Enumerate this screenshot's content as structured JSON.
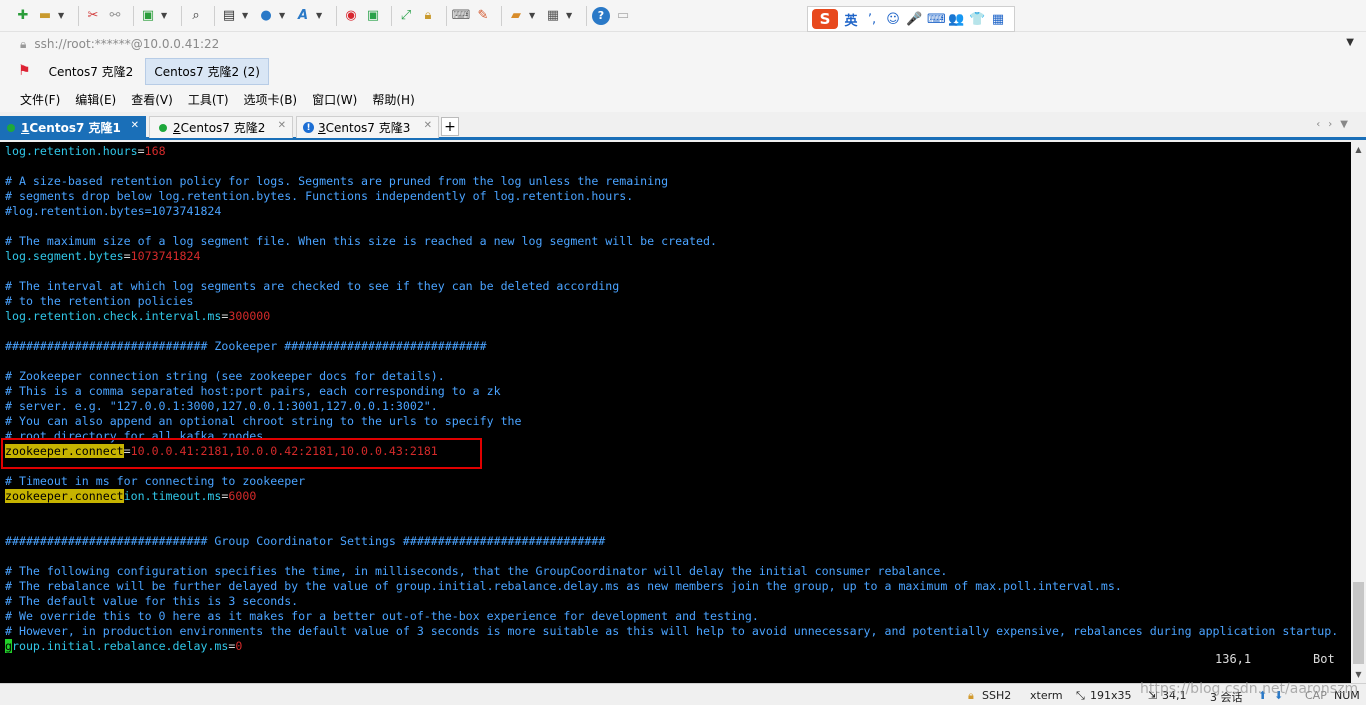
{
  "ime": {
    "logo": "S",
    "lang": "英",
    "items": [
      "ʼ,",
      "☺",
      "🎤",
      "⌨",
      "👥",
      "👕",
      "▦"
    ]
  },
  "address": {
    "url": "ssh://root:******@10.0.0.41:22"
  },
  "sessions": [
    "Centos7 克隆2",
    "Centos7 克隆2 (2)"
  ],
  "menu": [
    "文件(F)",
    "编辑(E)",
    "查看(V)",
    "工具(T)",
    "选项卡(B)",
    "窗口(W)",
    "帮助(H)"
  ],
  "tabs": [
    {
      "num": "1",
      "label": " Centos7 克隆1",
      "status": "connected",
      "active": true
    },
    {
      "num": "2",
      "label": " Centos7 克隆2",
      "status": "connected",
      "active": false
    },
    {
      "num": "3",
      "label": " Centos7 克隆3",
      "status": "warning",
      "active": false
    }
  ],
  "terminal": {
    "lines": [
      [
        [
          "k",
          "log.retention.hours"
        ],
        [
          "e",
          "="
        ],
        [
          "v",
          "168"
        ]
      ],
      [],
      [
        [
          "c",
          "# A size-based retention policy for logs. Segments are pruned from the log unless the remaining"
        ]
      ],
      [
        [
          "c",
          "# segments drop below log.retention.bytes. Functions independently of log.retention.hours."
        ]
      ],
      [
        [
          "c",
          "#log.retention.bytes=1073741824"
        ]
      ],
      [],
      [
        [
          "c",
          "# The maximum size of a log segment file. When this size is reached a new log segment will be created."
        ]
      ],
      [
        [
          "k",
          "log.segment.bytes"
        ],
        [
          "e",
          "="
        ],
        [
          "v",
          "1073741824"
        ]
      ],
      [],
      [
        [
          "c",
          "# The interval at which log segments are checked to see if they can be deleted according"
        ]
      ],
      [
        [
          "c",
          "# to the retention policies"
        ]
      ],
      [
        [
          "k",
          "log.retention.check.interval.ms"
        ],
        [
          "e",
          "="
        ],
        [
          "v",
          "300000"
        ]
      ],
      [],
      [
        [
          "c",
          "############################# Zookeeper #############################"
        ]
      ],
      [],
      [
        [
          "c",
          "# Zookeeper connection string (see zookeeper docs for details)."
        ]
      ],
      [
        [
          "c",
          "# This is a comma separated host:port pairs, each corresponding to a zk"
        ]
      ],
      [
        [
          "c",
          "# server. e.g. \"127.0.0.1:3000,127.0.0.1:3001,127.0.0.1:3002\"."
        ]
      ],
      [
        [
          "c",
          "# You can also append an optional chroot string to the urls to specify the"
        ]
      ],
      [
        [
          "c",
          "# root directory for all kafka znodes."
        ]
      ],
      [
        [
          "h",
          "zookeeper.connect"
        ],
        [
          "e",
          "="
        ],
        [
          "v",
          "10.0.0.41:2181,10.0.0.42:2181,10.0.0.43:2181"
        ]
      ],
      [],
      [
        [
          "c",
          "# Timeout in ms for connecting to zookeeper"
        ]
      ],
      [
        [
          "h",
          "zookeeper.connect"
        ],
        [
          "k",
          "ion.timeout.ms"
        ],
        [
          "e",
          "="
        ],
        [
          "v",
          "6000"
        ]
      ],
      [],
      [],
      [
        [
          "c",
          "############################# Group Coordinator Settings #############################"
        ]
      ],
      [],
      [
        [
          "c",
          "# The following configuration specifies the time, in milliseconds, that the GroupCoordinator will delay the initial consumer rebalance."
        ]
      ],
      [
        [
          "c",
          "# The rebalance will be further delayed by the value of group.initial.rebalance.delay.ms as new members join the group, up to a maximum of max.poll.interval.ms."
        ]
      ],
      [
        [
          "c",
          "# The default value for this is 3 seconds."
        ]
      ],
      [
        [
          "c",
          "# We override this to 0 here as it makes for a better out-of-the-box experience for development and testing."
        ]
      ],
      [
        [
          "c",
          "# However, in production environments the default value of 3 seconds is more suitable as this will help to avoid unnecessary, and potentially expensive, rebalances during application startup."
        ]
      ],
      [
        [
          "cur",
          "g"
        ],
        [
          "k",
          "roup.initial.rebalance.delay.ms"
        ],
        [
          "e",
          "="
        ],
        [
          "v",
          "0"
        ]
      ]
    ],
    "position": "136,1",
    "scroll": "Bot"
  },
  "statusbar": {
    "protocol": "SSH2",
    "term": "xterm",
    "size": "191x35",
    "cursor": "34,1",
    "sessions": "3 会话",
    "caps": "CAP",
    "num": "NUM"
  },
  "watermark": "https://blog.csdn.net/aaronszm",
  "colors": {
    "accent": "#1a6fb8",
    "comment": "#4aa3ff",
    "key": "#31c7e8",
    "value": "#d42a2a",
    "highlight": "#c6b300",
    "annotation_box": "#e00000"
  }
}
